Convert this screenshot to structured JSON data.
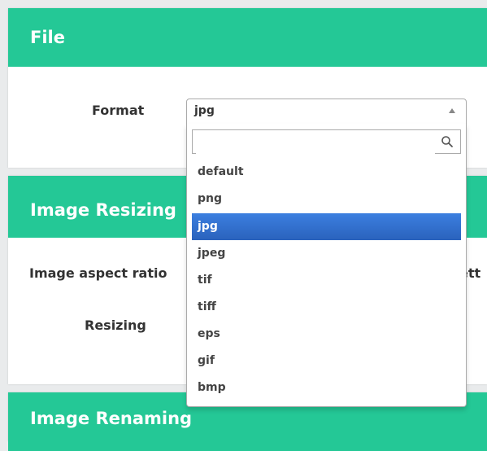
{
  "sections": {
    "file": {
      "title": "File",
      "format_label": "Format"
    },
    "image_resizing": {
      "title": "Image Resizing",
      "aspect_ratio_label": "Image aspect ratio",
      "aspect_ratio_trailing": "ett",
      "resizing_label": "Resizing"
    },
    "image_renaming": {
      "title": "Image Renaming"
    }
  },
  "format_select": {
    "selected": "jpg",
    "search_value": "",
    "options": [
      "default",
      "png",
      "jpg",
      "jpeg",
      "tif",
      "tiff",
      "eps",
      "gif",
      "bmp"
    ],
    "highlighted_index": 2
  },
  "colors": {
    "header": "#24c896",
    "selected_option": "#3875d7"
  }
}
